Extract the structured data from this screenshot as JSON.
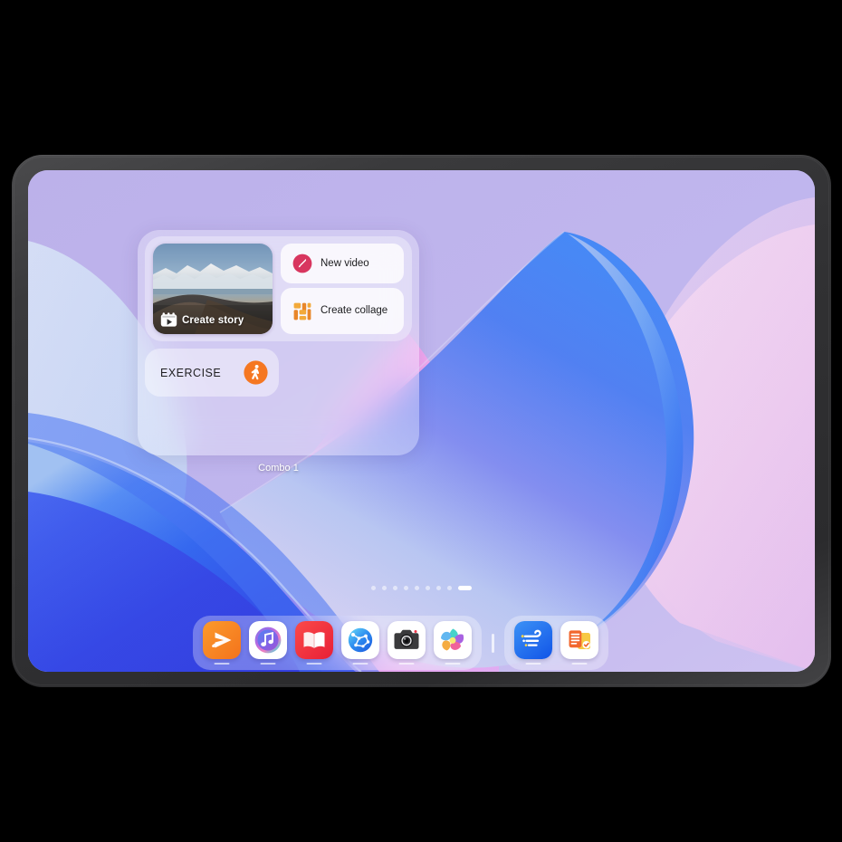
{
  "device": {
    "type": "tablet",
    "bezel_color": "#343436",
    "screen_bg": "#bdb2e9"
  },
  "wallpaper": {
    "name": "abstract-ribbon-wallpaper",
    "colors": {
      "lavender": "#bdb3ec",
      "pink": "#f0a0e8",
      "pale_pink": "#f5d3f0",
      "blue": "#2f6ef0",
      "deep_blue": "#2a3fe0",
      "light_blue": "#bfd8f5",
      "periwinkle": "#8a8ae8"
    }
  },
  "widget_panel": {
    "name": "Combo 1",
    "label": "Combo 1",
    "gallery_widget": {
      "story": {
        "label": "Create story",
        "icon": "story-film-icon",
        "thumbnail": "mountain-landscape-photo"
      },
      "actions": [
        {
          "label": "New video",
          "icon": "new-video-icon",
          "icon_color": "#d8365f"
        },
        {
          "label": "Create collage",
          "icon": "create-collage-icon",
          "icon_color": "#efa033"
        }
      ]
    },
    "exercise_widget": {
      "label": "EXERCISE",
      "icon": "walking-person-icon",
      "icon_color": "#f57722"
    }
  },
  "page_indicator": {
    "total": 9,
    "active_index": 8,
    "dots": [
      {
        "active": false
      },
      {
        "active": false
      },
      {
        "active": false
      },
      {
        "active": false
      },
      {
        "active": false
      },
      {
        "active": false
      },
      {
        "active": false
      },
      {
        "active": false
      },
      {
        "active": true
      }
    ]
  },
  "dock": {
    "apps": [
      {
        "name": "video-player",
        "icon": "huawei-video-icon",
        "running": true
      },
      {
        "name": "music",
        "icon": "music-note-icon",
        "running": true
      },
      {
        "name": "books",
        "icon": "open-book-icon",
        "running": true
      },
      {
        "name": "browser",
        "icon": "globe-browser-icon",
        "running": true
      },
      {
        "name": "camera",
        "icon": "camera-icon",
        "running": true
      },
      {
        "name": "gallery",
        "icon": "gallery-flower-icon",
        "running": true
      }
    ],
    "divider": true,
    "recent_apps": [
      {
        "name": "weather",
        "icon": "wind-weather-icon",
        "running": true
      },
      {
        "name": "notes",
        "icon": "notes-checklist-icon",
        "running": true
      }
    ]
  }
}
